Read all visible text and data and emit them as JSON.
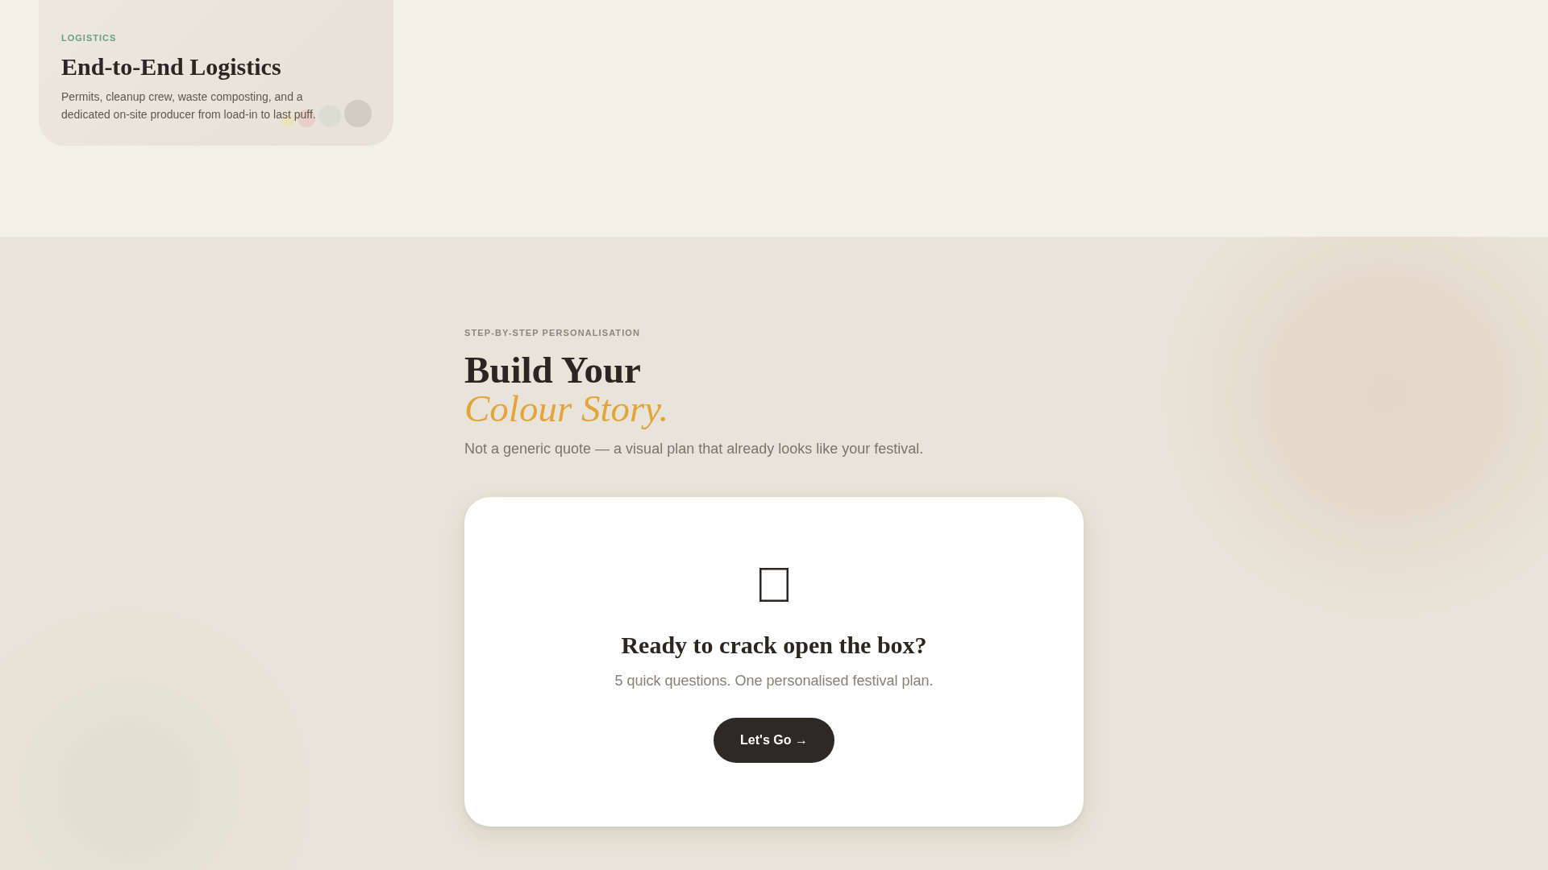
{
  "logistics_card": {
    "eyebrow": "LOGISTICS",
    "title": "End-to-End Logistics",
    "description": "Permits, cleanup crew, waste composting, and a dedicated on-site producer from load-in to last puff.",
    "dots": [
      {
        "color": "#ede0bd"
      },
      {
        "color": "#e8cfc8"
      },
      {
        "color": "#dcddd2"
      },
      {
        "color": "#d1ccc3"
      }
    ]
  },
  "personalisation": {
    "eyebrow": "STEP-BY-STEP PERSONALISATION",
    "title": "Build Your *Colour Story.*",
    "subtitle": "Not a generic quote — a visual plan that already looks like your festival.",
    "quiz_card": {
      "heading": "Ready to crack open the box?",
      "text": "5 quick questions. One personalised festival plan.",
      "button": "Let's Go →"
    }
  }
}
